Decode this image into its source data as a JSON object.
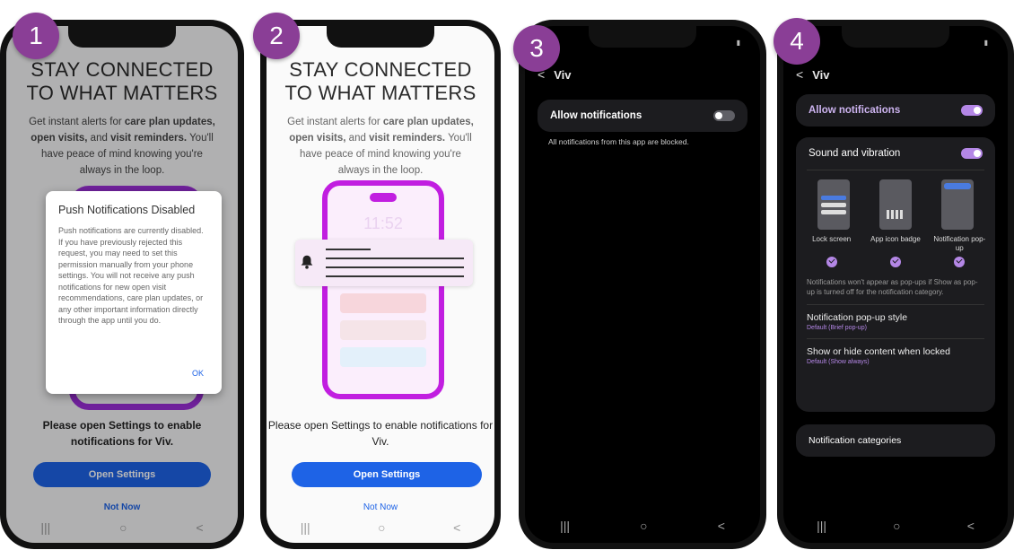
{
  "steps": [
    "1",
    "2",
    "3",
    "4"
  ],
  "light_screen": {
    "headline_line1": "STAY CONNECTED",
    "headline_line2": "TO WHAT MATTERS",
    "desc_a": "Get instant alerts for ",
    "desc_b": "care plan updates, open visits,",
    "desc_c": " and ",
    "desc_d": "visit reminders.",
    "desc_e": " You'll have peace of mind knowing you're always in the loop.",
    "enable_text": "Please open Settings to enable notifications for Viv.",
    "open_settings": "Open Settings",
    "not_now": "Not Now"
  },
  "dialog": {
    "title": "Push Notifications Disabled",
    "body": "Push notifications are currently disabled. If you have previously rejected this request, you may need to set this permission manually from your phone settings. You will not receive any push notifications for new open visit recommendations, care plan updates, or any other important information directly through the app until you do.",
    "ok": "OK"
  },
  "illustration": {
    "time": "11:52"
  },
  "dark_screen": {
    "app_name": "Viv",
    "allow_notifications": "Allow notifications",
    "blocked_text": "All notifications from this app are blocked.",
    "sound_vibration": "Sound and vibration",
    "lock_screen": "Lock screen",
    "app_icon_badge": "App icon badge",
    "notification_popup": "Notification pop-up",
    "hint": "Notifications won't appear as pop-ups if Show as pop-up is turned off for the notification category.",
    "popup_style": "Notification pop-up style",
    "popup_style_value": "Default (Brief pop-up)",
    "show_hide": "Show or hide content when locked",
    "show_hide_value": "Default (Show always)",
    "categories": "Notification categories"
  },
  "toggles": {
    "screen3_allow": false,
    "screen4_allow": true,
    "screen4_sound": true
  },
  "colors": {
    "badge": "#8a3e96",
    "button_blue": "#1e63e6",
    "illustration_purple": "#c11ee0",
    "toggle_on": "#b487e6"
  },
  "nav_glyphs": {
    "recents": "|||",
    "home": "○",
    "back": "<"
  }
}
